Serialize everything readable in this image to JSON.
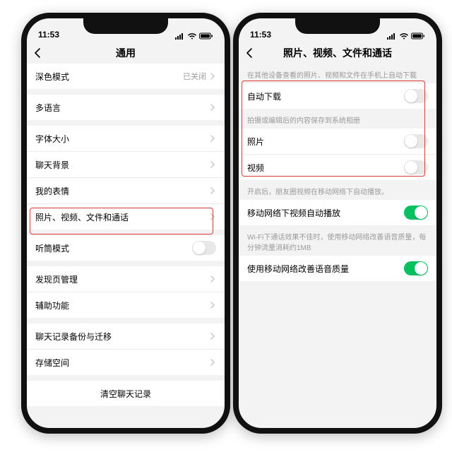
{
  "status": {
    "time": "11:53"
  },
  "left": {
    "title": "通用",
    "rows": {
      "dark": {
        "label": "深色模式",
        "value": "已关闭"
      },
      "lang": {
        "label": "多语言"
      },
      "font": {
        "label": "字体大小"
      },
      "chatbg": {
        "label": "聊天背景"
      },
      "emoji": {
        "label": "我的表情"
      },
      "media": {
        "label": "照片、视频、文件和通话"
      },
      "earpiece": {
        "label": "听筒模式"
      },
      "discover": {
        "label": "发现页管理"
      },
      "a11y": {
        "label": "辅助功能"
      },
      "backup": {
        "label": "聊天记录备份与迁移"
      },
      "storage": {
        "label": "存储空间"
      },
      "clear": {
        "label": "清空聊天记录"
      }
    }
  },
  "right": {
    "title": "照片、视频、文件和通话",
    "hints": {
      "autodl": "在其他设备查看的照片、视频和文件在手机上自动下载",
      "save": "拍摄或编辑后的内容保存到系统相册",
      "autoplay": "开启后，朋友圈视频在移动网络下自动播放。",
      "voice": "Wi-Fi下通话效果不佳时，使用移动网络改善语音质量，每分钟流量消耗约1MB"
    },
    "rows": {
      "autodl": {
        "label": "自动下载"
      },
      "photo": {
        "label": "照片"
      },
      "video": {
        "label": "视频"
      },
      "autoplay": {
        "label": "移动网络下视频自动播放"
      },
      "voice": {
        "label": "使用移动网络改善语音质量"
      }
    }
  }
}
